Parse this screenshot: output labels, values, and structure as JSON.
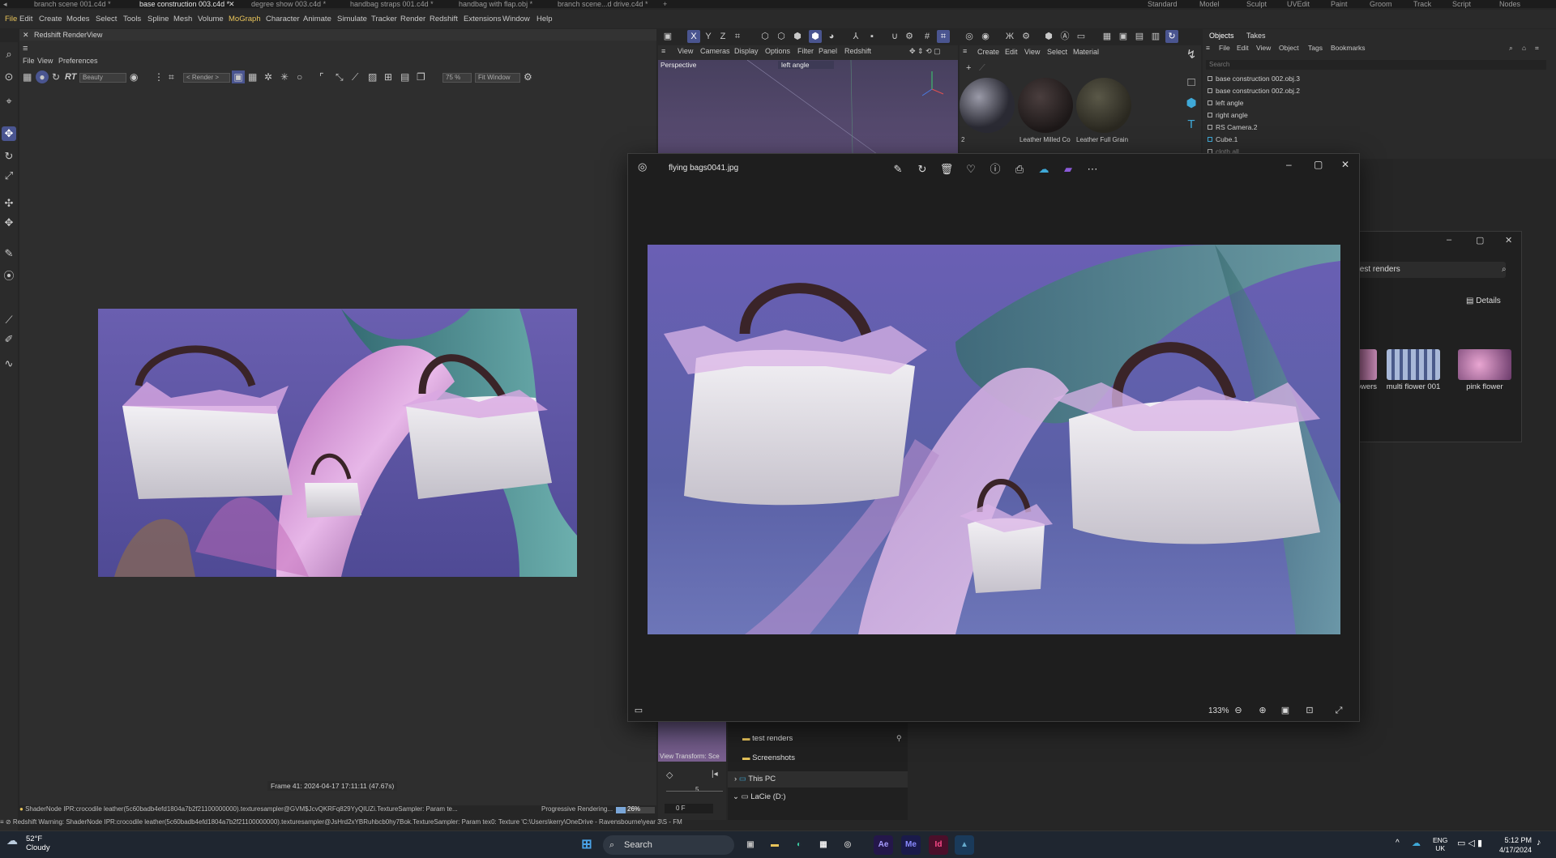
{
  "tabs": [
    "branch scene 001.c4d *",
    "base construction 003.c4d *",
    "degree show 003.c4d *",
    "handbag straps 001.c4d *",
    "handbag with flap.obj *",
    "branch scene...d drive.c4d *"
  ],
  "layouts": [
    "Standard",
    "Model",
    "Sculpt",
    "UVEdit",
    "Paint",
    "Groom",
    "Track",
    "Script",
    "Nodes"
  ],
  "menu": [
    "File",
    "Edit",
    "Create",
    "Modes",
    "Select",
    "Tools",
    "Spline",
    "Mesh",
    "Volume",
    "MoGraph",
    "Character",
    "Animate",
    "Simulate",
    "Tracker",
    "Render",
    "Redshift",
    "Extensions",
    "Window",
    "Help"
  ],
  "renderview": {
    "title": "Redshift RenderView",
    "menu": [
      "File",
      "View",
      "Preferences"
    ],
    "aov": "Beauty",
    "render_mode": "< Render >",
    "zoom": "75 %",
    "fit": "Fit Window",
    "frame_info": "Frame 41:  2024-04-17  17:11:11  (47.67s)"
  },
  "viewport": {
    "menu": [
      "View",
      "Cameras",
      "Display",
      "Options",
      "Filter",
      "Panel",
      "Redshift"
    ],
    "label": "Perspective",
    "camera": "left angle"
  },
  "materials": {
    "menu": [
      "Create",
      "Edit",
      "View",
      "Select",
      "Material"
    ],
    "items": [
      "2",
      "Leather Milled Co",
      "Leather Full Grain"
    ]
  },
  "objects": {
    "tabs": [
      "Objects",
      "Takes"
    ],
    "menu": [
      "File",
      "Edit",
      "View",
      "Object",
      "Tags",
      "Bookmarks"
    ],
    "search_placeholder": "Search",
    "rows": [
      "base construction 002.obj.3",
      "base construction 002.obj.2",
      "left angle",
      "right angle",
      "RS Camera.2",
      "Cube.1",
      "cloth all"
    ]
  },
  "photo_viewer": {
    "filename": "flying bags0041.jpg",
    "zoom": "133%"
  },
  "explorer": {
    "search": "test renders",
    "details": "Details",
    "thumbs": [
      "flowers",
      "multi flower 001",
      "pink flower"
    ],
    "nav": [
      "test renders",
      "Screenshots",
      "This PC",
      "LaCie (D:)"
    ],
    "view_transform": "View Transform: Sce"
  },
  "timeline": {
    "frame": "0 F",
    "tick": "5"
  },
  "status": {
    "line1": "ShaderNode IPR:crocodile leather(5c60badb4efd1804a7b2f21100000000).texturesampler@GVM$JcvQKRFq829YyQIUZi.TextureSampler: Param te...",
    "progress": "Progressive Rendering...",
    "progress_pct": "26%",
    "line2": "Redshift Warning: ShaderNode IPR:crocodile leather(5c60badb4efd1804a7b2f21100000000).texturesampler@JsHrd2xYBRuhbcb0hy7Bok.TextureSampler: Param tex0: Texture 'C:\\Users\\kerry\\OneDrive - Ravensbourne\\year 3\\S - FM"
  },
  "taskbar": {
    "temp": "52°F",
    "weather": "Cloudy",
    "search": "Search",
    "lang1": "ENG",
    "lang2": "UK",
    "time": "5:12 PM",
    "date": "4/17/2024",
    "apps": [
      "Ae",
      "Me",
      "Id"
    ]
  },
  "colors": {
    "accent": "#4a5590",
    "sky": "#5a5fa0",
    "mograph": "#e8c45a"
  }
}
